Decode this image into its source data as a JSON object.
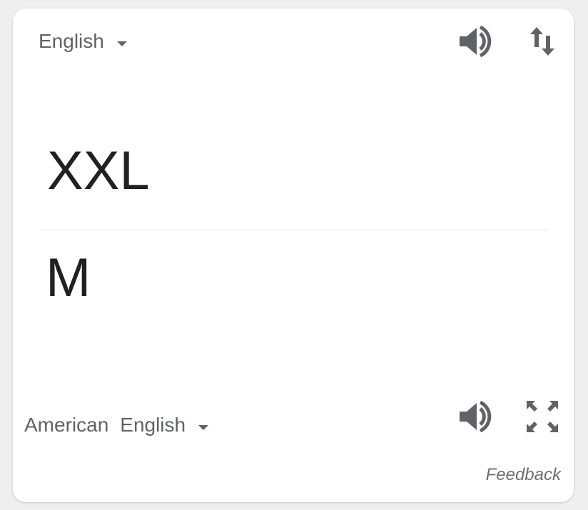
{
  "source": {
    "language": "English",
    "text": "XXL"
  },
  "target": {
    "language_word1": "American",
    "language_word2": "English",
    "text": "M"
  },
  "icons": {
    "source_speaker": "speaker-icon",
    "swap": "swap-arrows-icon",
    "target_speaker": "speaker-icon",
    "expand": "fullscreen-icon"
  },
  "footer": {
    "feedback_label": "Feedback"
  },
  "colors": {
    "icon": "#5f6368",
    "text": "#202124",
    "card_background": "#ffffff",
    "page_background": "#efefef"
  }
}
